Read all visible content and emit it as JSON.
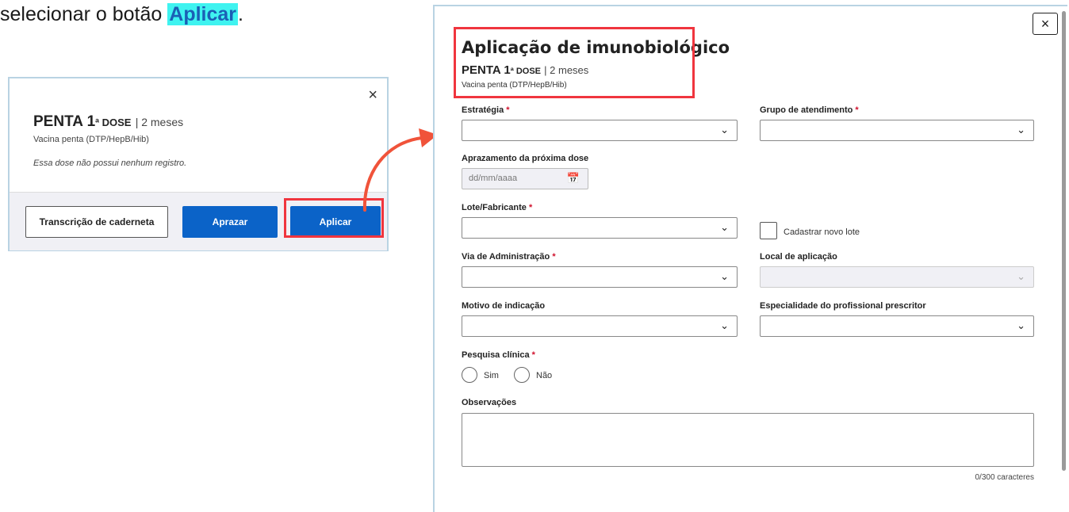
{
  "instruction": {
    "prefix": "selecionar o botão ",
    "highlight": "Aplicar",
    "suffix": "."
  },
  "mini_dialog": {
    "close": "×",
    "vaccine_name": "PENTA",
    "dose_number": "1",
    "dose_sup": "ª DOSE",
    "age": "| 2 meses",
    "vaccine_desc": "Vacina penta (DTP/HepB/Hib)",
    "no_record": "Essa dose não possui nenhum registro.",
    "buttons": {
      "transcricao": "Transcrição de caderneta",
      "aprazar": "Aprazar",
      "aplicar": "Aplicar"
    }
  },
  "form": {
    "close": "×",
    "title": "Aplicação de imunobiológico",
    "vaccine_name": "PENTA",
    "dose_number": "1",
    "dose_sup": "ª DOSE",
    "age": "| 2 meses",
    "vaccine_desc": "Vacina penta (DTP/HepB/Hib)",
    "required_mark": "*",
    "fields": {
      "estrategia": "Estratégia",
      "grupo": "Grupo de atendimento",
      "aprazamento": "Aprazamento da próxima dose",
      "date_placeholder": "dd/mm/aaaa",
      "lote": "Lote/Fabricante",
      "novo_lote": "Cadastrar novo lote",
      "via": "Via de Administração",
      "local": "Local de aplicação",
      "motivo": "Motivo de indicação",
      "especialidade": "Especialidade do profissional prescritor",
      "pesquisa": "Pesquisa clínica",
      "sim": "Sim",
      "nao": "Não",
      "observacoes": "Observações",
      "char_count": "0/300 caracteres"
    },
    "chevron": "⌄",
    "calendar": "📅"
  },
  "colors": {
    "primary_button": "#0b63c8",
    "highlight_box": "#f0353e",
    "instruction_highlight": "#3ff3f0",
    "required": "#d0122d"
  }
}
